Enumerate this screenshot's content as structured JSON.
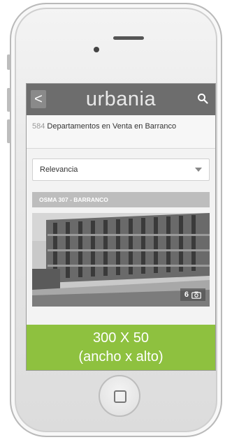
{
  "app": {
    "logo": "urbania",
    "back_label": "<"
  },
  "results": {
    "count": "584",
    "title": "Departamentos en Venta en Barranco"
  },
  "sort": {
    "selected": "Relevancia"
  },
  "listing": {
    "title": "OSMA 307 - BARRANCO",
    "photo_count": "6"
  },
  "ad": {
    "line1": "300 X 50",
    "line2": "(ancho x alto)"
  },
  "colors": {
    "header": "#6d6d6d",
    "ad_green": "#8ec13f"
  },
  "icons": [
    "back-icon",
    "search-icon",
    "camera-icon",
    "home-button-icon"
  ]
}
